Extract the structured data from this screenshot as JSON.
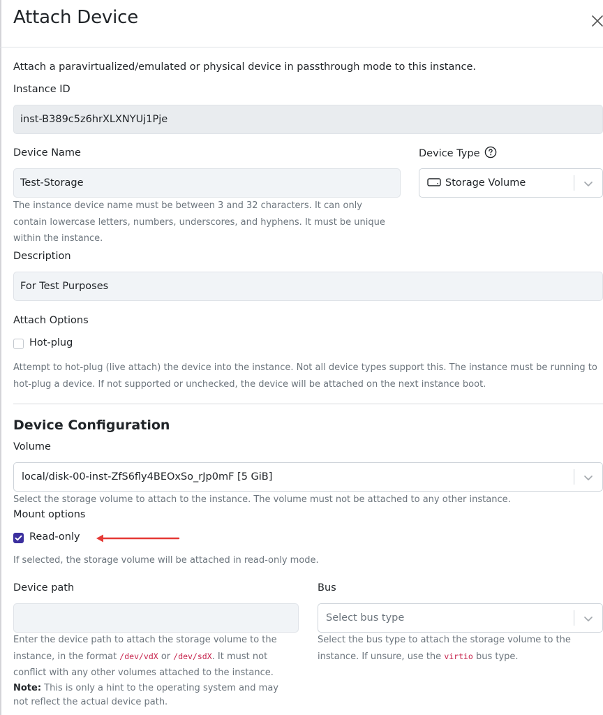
{
  "modal": {
    "title": "Attach Device",
    "intro": "Attach a paravirtualized/emulated or physical device in passthrough mode to this instance."
  },
  "instance_id": {
    "label": "Instance ID",
    "value": "inst-B389c5z6hrXLXNYUj1Pje"
  },
  "device_name": {
    "label": "Device Name",
    "value": "Test-Storage",
    "help": "The instance device name must be between 3 and 32 characters. It can only contain lowercase letters, numbers, underscores, and hyphens. It must be unique within the instance."
  },
  "device_type": {
    "label": "Device Type",
    "value": "Storage Volume",
    "icon": "storage-drive-icon"
  },
  "description": {
    "label": "Description",
    "value": "For Test Purposes"
  },
  "attach_options": {
    "label": "Attach Options",
    "hotplug_label": "Hot-plug",
    "hotplug_checked": false,
    "help": "Attempt to hot-plug (live attach) the device into the instance. Not all device types support this. The instance must be running to hot-plug a device. If not supported or unchecked, the device will be attached on the next instance boot."
  },
  "device_config": {
    "title": "Device Configuration",
    "volume": {
      "label": "Volume",
      "value": "local/disk-00-inst-ZfS6fly4BEOxSo_rJp0mF [5 GiB]",
      "help": "Select the storage volume to attach to the instance. The volume must not be attached to any other instance."
    },
    "mount_options": {
      "label": "Mount options",
      "readonly_label": "Read-only",
      "readonly_checked": true,
      "help": "If selected, the storage volume will be attached in read-only mode."
    },
    "device_path": {
      "label": "Device path",
      "value": "",
      "help_pre": "Enter the device path to attach the storage volume to the instance, in the format ",
      "code1": "/dev/vdX",
      "help_or": " or ",
      "code2": "/dev/sdX",
      "help_post": ". It must not conflict with any other volumes attached to the instance.",
      "note_label": "Note:",
      "note_text": " This is only a hint to the operating system and may not reflect the actual device path."
    },
    "bus": {
      "label": "Bus",
      "placeholder": "Select bus type",
      "help_pre": "Select the bus type to attach the storage volume to the instance. If unsure, use the ",
      "code": "virtio",
      "help_post": " bus type."
    }
  },
  "colors": {
    "accent": "#3b2f9e",
    "arrow": "#e53935",
    "input_bg": "#f1f4f7"
  }
}
